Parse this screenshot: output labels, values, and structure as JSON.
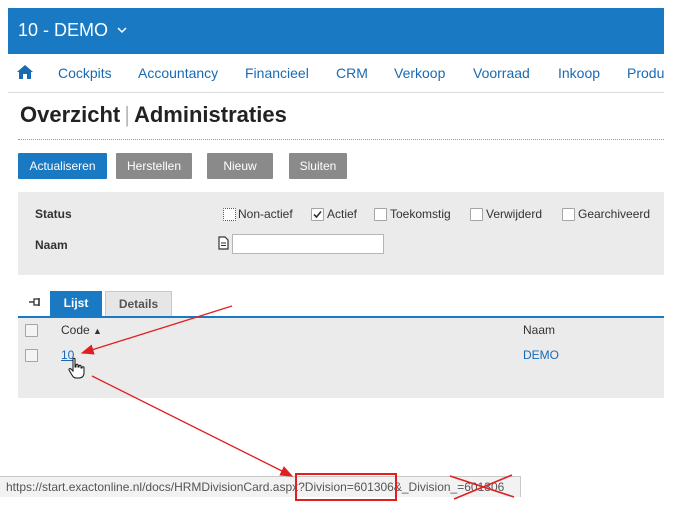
{
  "header": {
    "company": "10 - DEMO"
  },
  "nav": {
    "items": [
      "Cockpits",
      "Accountancy",
      "Financieel",
      "CRM",
      "Verkoop",
      "Voorraad",
      "Inkoop",
      "Produ"
    ]
  },
  "page": {
    "title_part1": "Overzicht",
    "separator": "|",
    "title_part2": "Administraties"
  },
  "toolbar": {
    "refresh": "Actualiseren",
    "restore": "Herstellen",
    "new": "Nieuw",
    "close": "Sluiten"
  },
  "filter": {
    "status_label": "Status",
    "name_label": "Naam",
    "name_value": "",
    "statuses": [
      {
        "label": "Non-actief",
        "checked": false
      },
      {
        "label": "Actief",
        "checked": true
      },
      {
        "label": "Toekomstig",
        "checked": false
      },
      {
        "label": "Verwijderd",
        "checked": false
      },
      {
        "label": "Gearchiveerd",
        "checked": false
      }
    ]
  },
  "tabs": {
    "list": "Lijst",
    "details": "Details"
  },
  "grid": {
    "columns": {
      "code": "Code",
      "name": "Naam"
    },
    "rows": [
      {
        "code": "10",
        "name": "DEMO"
      }
    ]
  },
  "statusbar": {
    "url_prefix": "https://start.exactonline.nl/docs/HRMDivisionCard.aspx?",
    "url_division": "Division=601306",
    "url_amp": "&",
    "url_division_underscore": "_Division_=601306"
  },
  "colors": {
    "primary": "#1a79c3",
    "button_gray": "#8a8a8a",
    "panel": "#ebebeb",
    "annotation": "#e02020"
  }
}
